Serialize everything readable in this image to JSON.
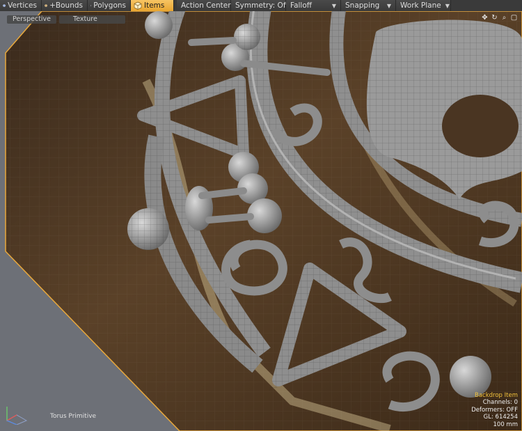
{
  "toolbar": {
    "buttons": [
      {
        "label": "Vertices",
        "icon": "vertices-cube-icon",
        "active": false
      },
      {
        "label": "+Bounds",
        "icon": "bounds-cube-icon",
        "active": false
      },
      {
        "label": "Polygons",
        "icon": "polygons-cube-icon",
        "active": false
      },
      {
        "label": "Items",
        "icon": "items-cube-icon",
        "active": true
      }
    ],
    "dropdowns": [
      {
        "label": "Action Center"
      },
      {
        "label": "Symmetry: Off"
      },
      {
        "label": "Falloff"
      },
      {
        "label": "Snapping"
      },
      {
        "label": "Work Plane"
      }
    ]
  },
  "viewport": {
    "view_mode": "Perspective",
    "shading_mode": "Texture",
    "selected_item": "Torus Primitive",
    "info": {
      "title": "Backdrop Item",
      "channels": "Channels: 0",
      "deformers": "Deformers: OFF",
      "gl": "GL: 614254",
      "scale": "100 mm"
    }
  },
  "colors": {
    "toolbar_bg": "#3a3a3a",
    "active_accent": "#f0b546",
    "info_title": "#f2c23c",
    "mesh_gray": "#9a9a9a",
    "backdrop_brown": "#4a3520"
  }
}
